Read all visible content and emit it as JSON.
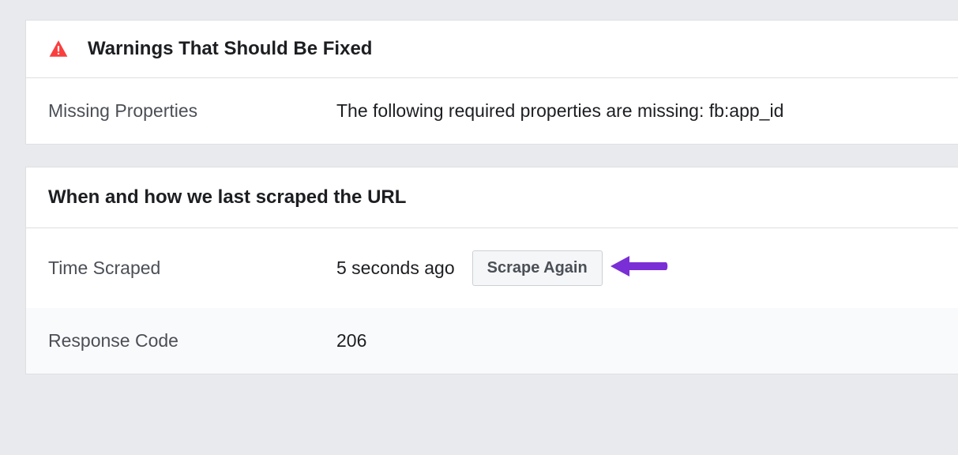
{
  "warnings": {
    "header": "Warnings That Should Be Fixed",
    "rows": [
      {
        "label": "Missing Properties",
        "value": "The following required properties are missing: fb:app_id"
      }
    ]
  },
  "scrape": {
    "header": "When and how we last scraped the URL",
    "time_label": "Time Scraped",
    "time_value": "5 seconds ago",
    "scrape_button": "Scrape Again",
    "response_label": "Response Code",
    "response_value": "206"
  }
}
